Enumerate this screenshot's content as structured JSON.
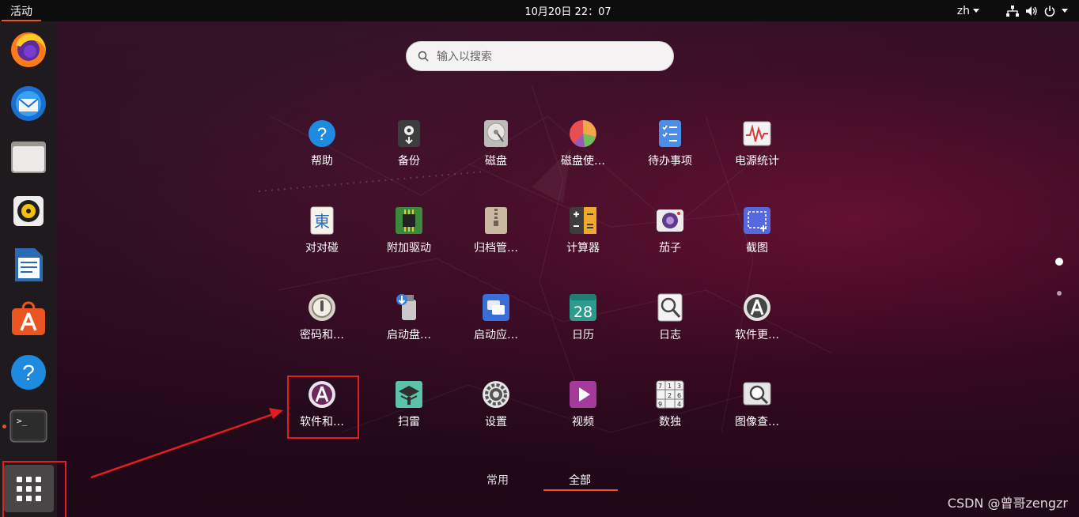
{
  "topbar": {
    "activities_label": "活动",
    "clock": "10月20日  22：07",
    "lang": "zh",
    "icons": [
      "network-icon",
      "volume-icon",
      "power-icon"
    ]
  },
  "dock": {
    "items": [
      {
        "name": "firefox-icon"
      },
      {
        "name": "thunderbird-icon"
      },
      {
        "name": "files-icon"
      },
      {
        "name": "rhythmbox-icon"
      },
      {
        "name": "libreoffice-writer-icon"
      },
      {
        "name": "software-icon"
      },
      {
        "name": "help-icon"
      },
      {
        "name": "terminal-icon"
      }
    ],
    "show_apps_icon": "app-grid-icon"
  },
  "search": {
    "placeholder": "输入以搜索"
  },
  "apps": [
    {
      "label": "帮助",
      "icon": "help-icon"
    },
    {
      "label": "备份",
      "icon": "backup-icon"
    },
    {
      "label": "磁盘",
      "icon": "disk-icon"
    },
    {
      "label": "磁盘使…",
      "icon": "disk-usage-icon"
    },
    {
      "label": "待办事项",
      "icon": "todo-icon"
    },
    {
      "label": "电源统计",
      "icon": "power-stats-icon"
    },
    {
      "label": "对对碰",
      "icon": "mahjongg-icon"
    },
    {
      "label": "附加驱动",
      "icon": "driver-icon"
    },
    {
      "label": "归档管…",
      "icon": "archive-icon"
    },
    {
      "label": "计算器",
      "icon": "calculator-icon"
    },
    {
      "label": "茄子",
      "icon": "cheese-icon"
    },
    {
      "label": "截图",
      "icon": "screenshot-icon"
    },
    {
      "label": "密码和…",
      "icon": "passwords-icon"
    },
    {
      "label": "启动盘…",
      "icon": "usb-creator-icon"
    },
    {
      "label": "启动应…",
      "icon": "startup-apps-icon"
    },
    {
      "label": "日历",
      "icon": "calendar-icon"
    },
    {
      "label": "日志",
      "icon": "logs-icon"
    },
    {
      "label": "软件更…",
      "icon": "software-updater-icon"
    },
    {
      "label": "软件和…",
      "icon": "software-properties-icon"
    },
    {
      "label": "扫雷",
      "icon": "mines-icon"
    },
    {
      "label": "设置",
      "icon": "settings-icon"
    },
    {
      "label": "视频",
      "icon": "videos-icon"
    },
    {
      "label": "数独",
      "icon": "sudoku-icon"
    },
    {
      "label": "图像查…",
      "icon": "image-viewer-icon"
    }
  ],
  "calendar_day": "28",
  "tabs": {
    "frequent": "常用",
    "all": "全部",
    "active": "all"
  },
  "pager": {
    "pages": 2,
    "current": 1
  },
  "watermark": "CSDN @曾哥zengzr",
  "colors": {
    "accent": "#e95420",
    "annotation": "#e02020"
  }
}
